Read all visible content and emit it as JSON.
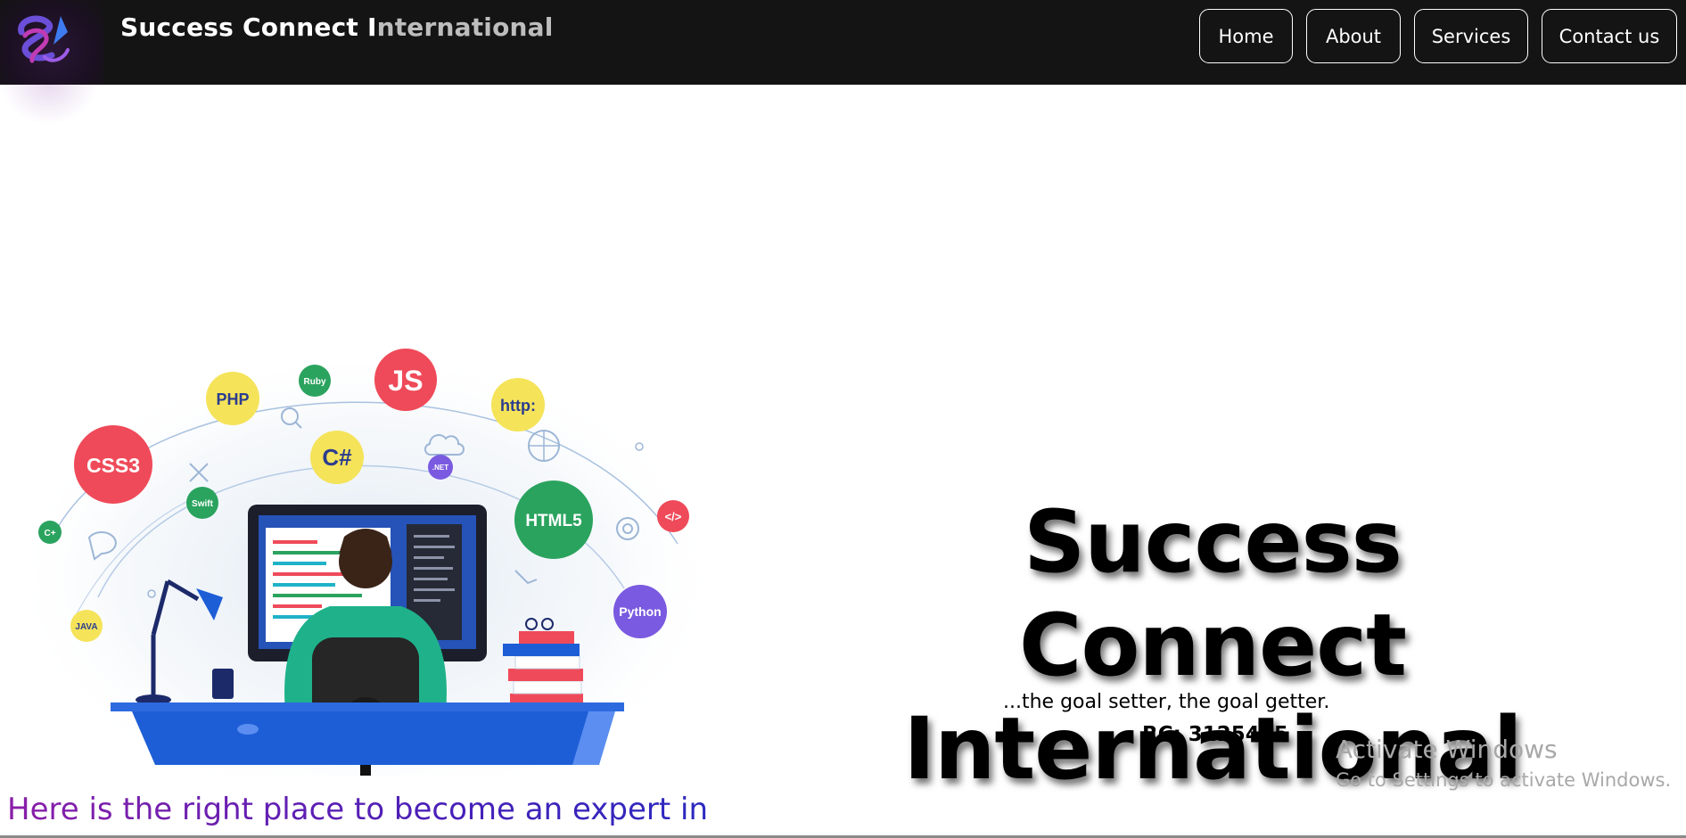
{
  "header": {
    "brand_main": "Success Connect I",
    "brand_fade": "nternational",
    "nav": {
      "home": "Home",
      "about": "About",
      "services": "Services",
      "contact": "Contact us"
    }
  },
  "hero": {
    "illustration_labels": {
      "css3": "CSS3",
      "php": "PHP",
      "ruby": "Ruby",
      "js": "JS",
      "http": "http:",
      "csharp": "C#",
      "dotnet": ".NET",
      "swift": "Swift",
      "html5": "HTML5",
      "code": "</>",
      "cplus": "C+",
      "python": "Python",
      "java": "JAVA"
    },
    "title_line1": "Success Connect",
    "title_line2": "International",
    "tagline": "...the goal setter, the goal getter.",
    "rc": "RC: 3125405",
    "intro": "Here is the right place to become an expert in different computer skills"
  },
  "os_overlay": {
    "line1": "Activate Windows",
    "line2": "Go to Settings to activate Windows."
  },
  "colors": {
    "navbar": "#141414",
    "red_bubble": "#ef4a59",
    "yellow_bubble": "#f5e35a",
    "green_bubble": "#2aa35e",
    "purple_bubble": "#7a5ae0",
    "desk_blue": "#1d5ed6",
    "shirt_teal": "#1fb28a"
  }
}
